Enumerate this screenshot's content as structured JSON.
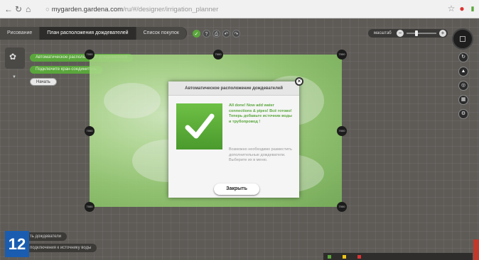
{
  "browser": {
    "url_host": "mygarden.gardena.com",
    "url_path": "/ru/#/designer/irrigation_planner"
  },
  "tabs": [
    {
      "label": "Рисование"
    },
    {
      "label": "План расположения дождевателей"
    },
    {
      "label": "Список покупок"
    }
  ],
  "zoom": {
    "label": "масштаб"
  },
  "side_panel": {
    "auto_button": "Автоматическое расположение дождевателей",
    "connect_button": "Подключите кран-соединитель",
    "start_button": "Начать"
  },
  "dialog": {
    "title": "Автоматическое расположение дождевателей",
    "message": "All done! Now add water connections & pipes! Всё готово! Теперь добавьте источник воды и трубопровод !",
    "note": "Возможно необходимо разместить дополнительные дождеватели. Выберите их в меню.",
    "close_label": "Закрыть"
  },
  "badge": "12",
  "bottom_chips": [
    "ть дождеватели",
    "подключения к источнику воды"
  ],
  "marker_label": "7000",
  "colors": {
    "accent": "#5aa63c",
    "badge": "#1a5db0"
  }
}
